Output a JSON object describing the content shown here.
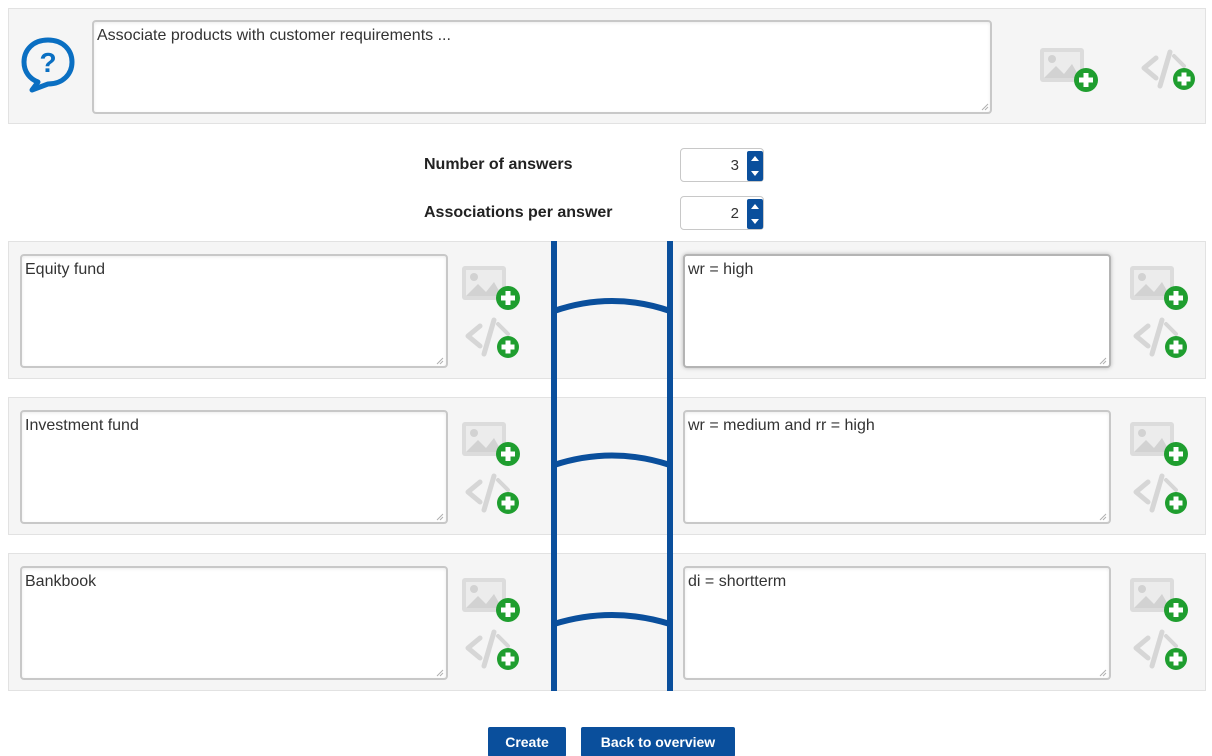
{
  "question": {
    "text": "Associate products with customer requirements ..."
  },
  "controls": {
    "answers_label": "Number of answers",
    "answers_value": "3",
    "associations_label": "Associations per answer",
    "associations_value": "2"
  },
  "rows": [
    {
      "left": "Equity fund",
      "right": "wr = high"
    },
    {
      "left": "Investment fund",
      "right": "wr = medium and rr = high"
    },
    {
      "left": "Bankbook",
      "right": "di = shortterm"
    }
  ],
  "buttons": {
    "create": "Create",
    "back": "Back to overview"
  },
  "colors": {
    "accent": "#0a4f9c",
    "add_green": "#1f9e2f",
    "icon_gray": "#d6d6d6"
  },
  "icons": {
    "help": "speech-bubble-question-icon",
    "add_image": "add-image-icon",
    "add_code": "add-code-icon"
  }
}
